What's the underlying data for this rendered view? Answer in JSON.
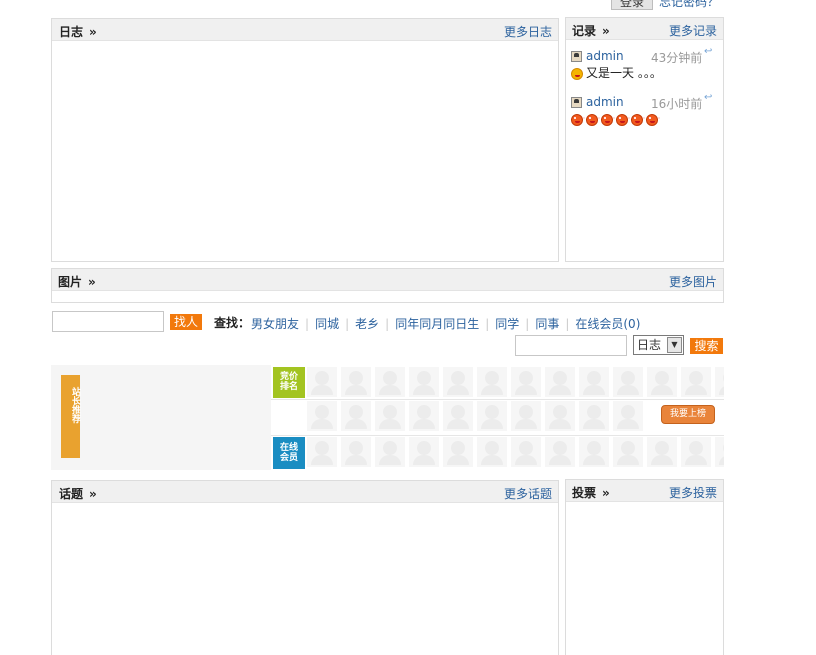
{
  "login": {
    "button_label": "登录",
    "forgot_link": "忘记密码？"
  },
  "blog": {
    "title": "日志",
    "more": "更多日志"
  },
  "records": {
    "title": "记录",
    "more": "更多记录",
    "items": [
      {
        "user": "admin",
        "time": "43分钟前",
        "text": "又是一天 。。。",
        "emoticon": "grin-icon"
      },
      {
        "user": "admin",
        "time": "16小时前",
        "text": "",
        "emoticon": "heart-eyes-icon",
        "emoticon_count": 6
      }
    ]
  },
  "photos": {
    "title": "图片",
    "more": "更多图片"
  },
  "find": {
    "button_label": "找人",
    "label": "查找：",
    "links": [
      "男女朋友",
      "同城",
      "老乡",
      "同年同月同日生",
      "同学",
      "同事",
      "在线会员(0)"
    ]
  },
  "search": {
    "select_value": "日志",
    "button_label": "搜索"
  },
  "members": {
    "recommend_label": "站长推荐",
    "ranking_label": "竞价排名",
    "online_label": "在线会员",
    "rank_button": "我要上榜"
  },
  "topics": {
    "title": "话题",
    "more": "更多话题"
  },
  "polls": {
    "title": "投票",
    "more": "更多投票"
  }
}
